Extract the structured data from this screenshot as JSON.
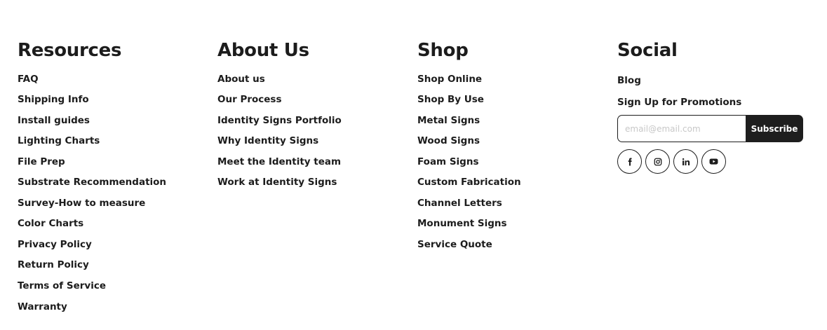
{
  "resources": {
    "title": "Resources",
    "links": [
      "FAQ",
      "Shipping Info",
      "Install guides",
      "Lighting Charts",
      "File Prep",
      "Substrate Recommendation",
      "Survey-How to measure",
      "Color Charts",
      "Privacy Policy",
      "Return Policy",
      "Terms of Service",
      "Warranty"
    ]
  },
  "about": {
    "title": "About Us",
    "links": [
      "About us",
      "Our Process",
      "Identity Signs Portfolio",
      "Why Identity Signs",
      "Meet the Identity team",
      "Work at Identity Signs"
    ]
  },
  "shop": {
    "title": "Shop",
    "links": [
      "Shop Online",
      "Shop By Use",
      "Metal Signs",
      "Wood Signs",
      "Foam Signs",
      "Custom Fabrication",
      "Channel Letters",
      "Monument Signs",
      "Service Quote"
    ]
  },
  "social": {
    "title": "Social",
    "blog": "Blog",
    "promo_label": "Sign Up for Promotions",
    "email_placeholder": "email@email.com",
    "email_value": "",
    "subscribe_label": "Subscribe",
    "icons": [
      "facebook-icon",
      "instagram-icon",
      "linkedin-icon",
      "youtube-icon"
    ]
  }
}
